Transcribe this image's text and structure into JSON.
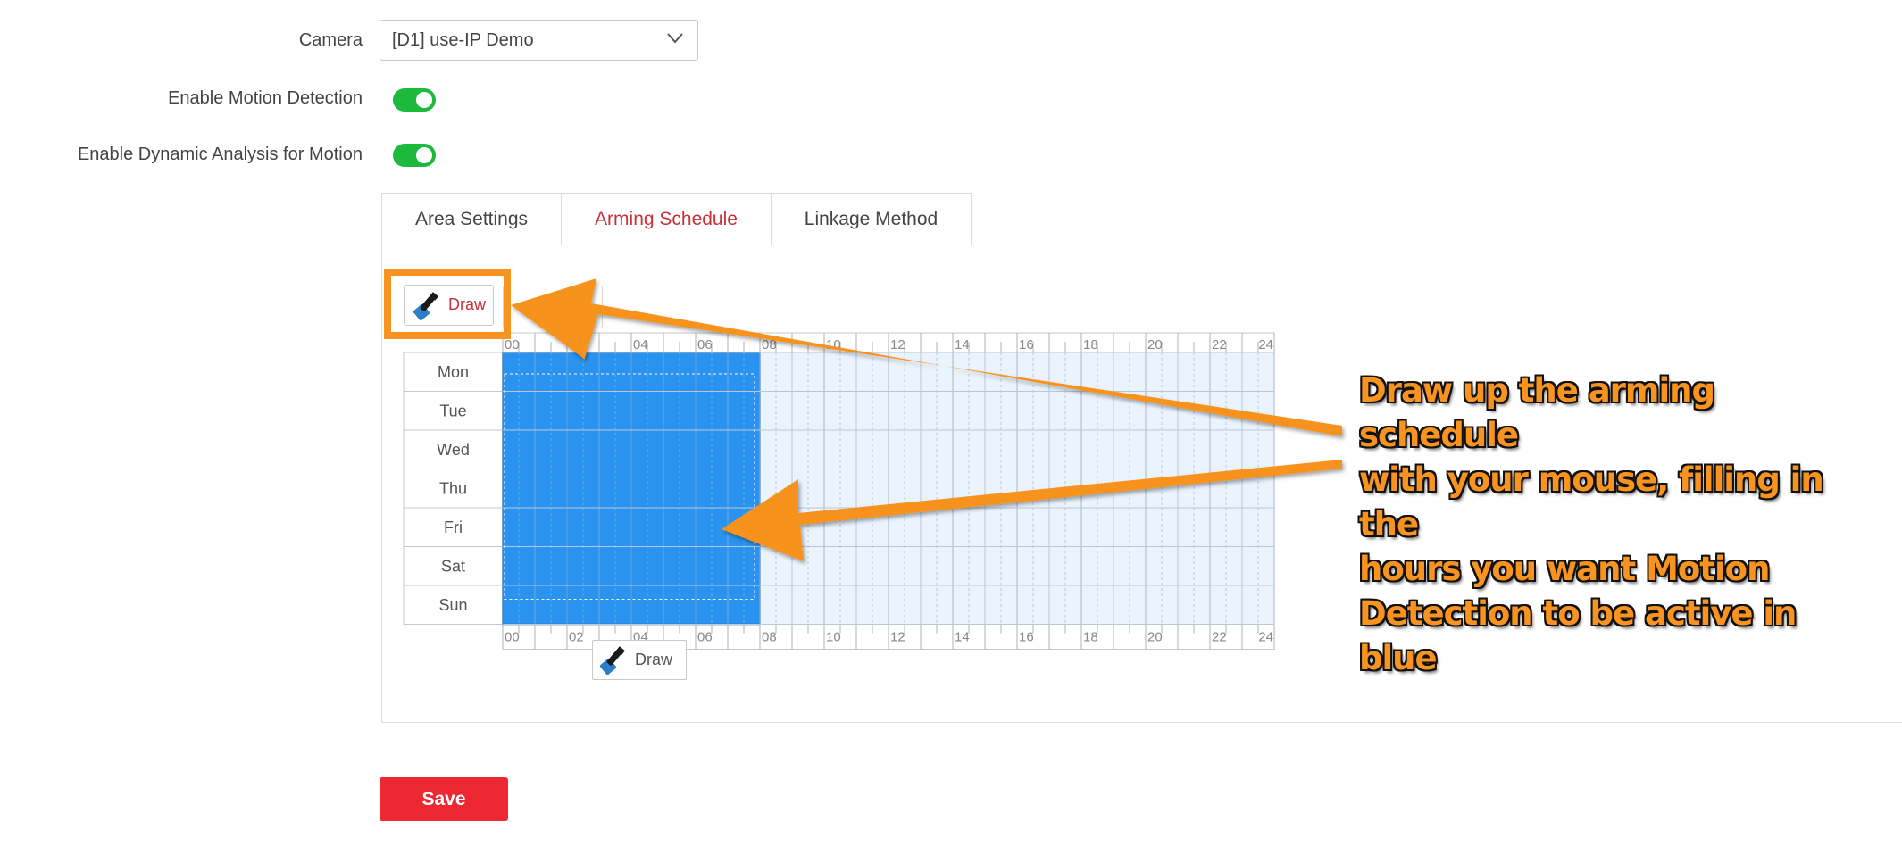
{
  "form": {
    "camera_label": "Camera",
    "camera_value": "[D1] use-IP Demo",
    "motion_label": "Enable Motion Detection",
    "motion_enabled": true,
    "dynamic_label": "Enable Dynamic Analysis for Motion",
    "dynamic_enabled": true
  },
  "tabs": [
    {
      "label": "Area Settings",
      "active": false
    },
    {
      "label": "Arming Schedule",
      "active": true
    },
    {
      "label": "Linkage Method",
      "active": false
    }
  ],
  "schedule": {
    "draw_label": "Draw",
    "draw_popup_label": "Draw",
    "days": [
      "Mon",
      "Tue",
      "Wed",
      "Thu",
      "Fri",
      "Sat",
      "Sun"
    ],
    "hour_ticks": [
      "00",
      "02",
      "04",
      "06",
      "08",
      "10",
      "12",
      "14",
      "16",
      "18",
      "20",
      "22",
      "24"
    ],
    "armed_start_hour": 0,
    "armed_end_hour": 8,
    "armed_color": "#2993ef",
    "grid_bg": "#ebf3fd"
  },
  "save_label": "Save",
  "annotation": {
    "text_lines": [
      "Draw up the arming schedule",
      "with your mouse, filling in the",
      "hours you want Motion",
      "Detection to be active in blue"
    ],
    "color": "#f7931e"
  }
}
